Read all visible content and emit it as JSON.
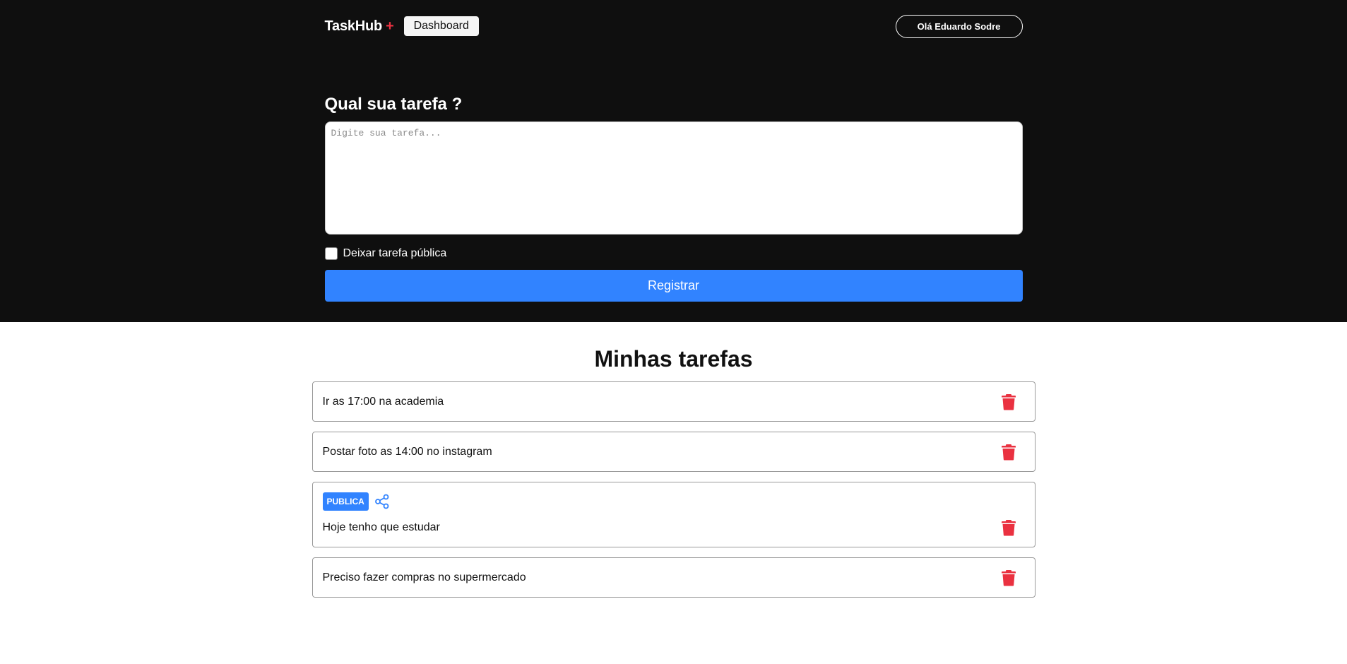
{
  "header": {
    "logo_text": "TaskHub",
    "logo_plus": "+",
    "dashboard_label": "Dashboard",
    "user_greeting": "Olá Eduardo Sodre"
  },
  "form": {
    "title": "Qual sua tarefa ?",
    "placeholder": "Digite sua tarefa...",
    "public_label": "Deixar tarefa pública",
    "register_label": "Registrar"
  },
  "tasks": {
    "title": "Minhas tarefas",
    "items": [
      {
        "text": "Ir as 17:00 na academia",
        "public": false
      },
      {
        "text": "Postar foto as 14:00 no instagram",
        "public": false
      },
      {
        "text": "Hoje tenho que estudar",
        "public": true,
        "badge": "PUBLICA"
      },
      {
        "text": "Preciso fazer compras no supermercado",
        "public": false
      }
    ]
  },
  "colors": {
    "accent": "#3183ff",
    "danger": "#ea3140",
    "header_bg": "#0f0f0f"
  }
}
